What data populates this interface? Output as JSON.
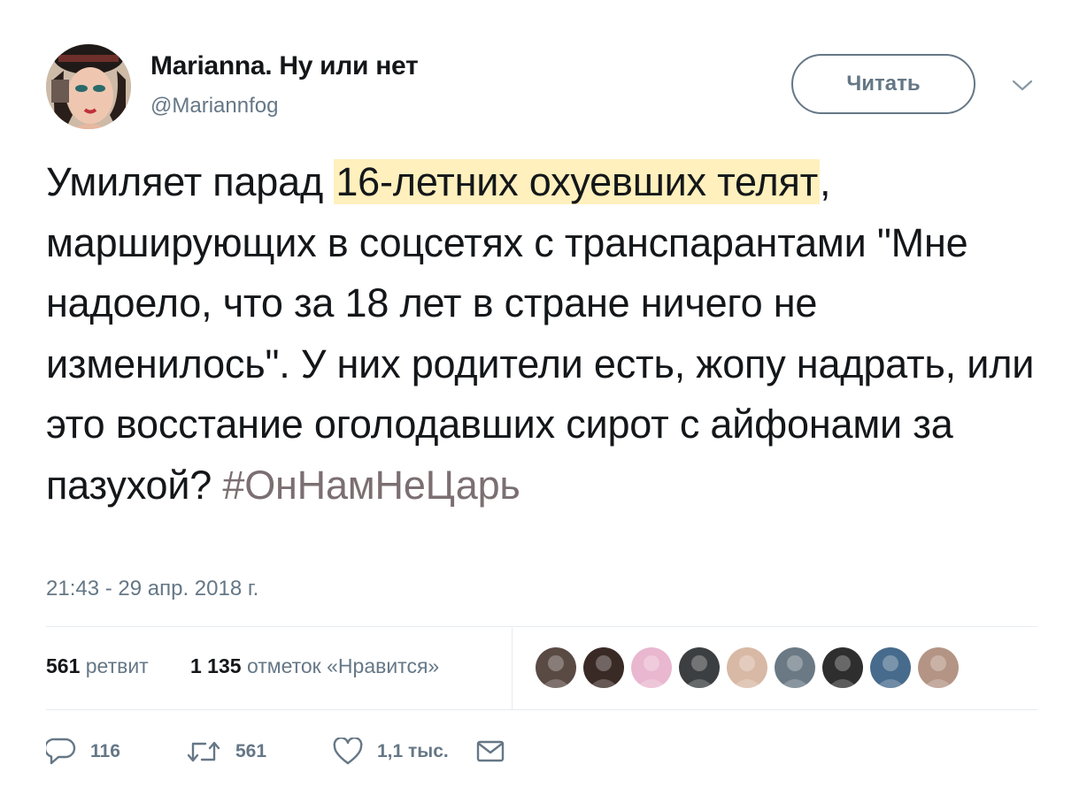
{
  "user": {
    "display_name": "Marianna. Ну или нет",
    "handle": "@Mariannfog"
  },
  "follow_label": "Читать",
  "tweet": {
    "text_before": "Умиляет парад ",
    "text_highlighted": "16-летних охуевших телят",
    "text_after": ", марширующих в соцсетях с транспарантами \"Мне надоело, что за 18 лет в стране ничего не изменилось\". У них родители есть, жопу надрать, или это восстание оголодавших сирот с айфонами за пазухой? ",
    "hashtag": "#ОнНамНеЦарь",
    "timestamp": "21:43 - 29 апр. 2018 г."
  },
  "stats": {
    "retweets_count": "561",
    "retweets_label": "ретвит",
    "likes_count": "1 135",
    "likes_label": "отметок «Нравится»"
  },
  "likers": [
    {
      "name": "liker-1",
      "color": "#5a4a44"
    },
    {
      "name": "liker-2",
      "color": "#3a2a26"
    },
    {
      "name": "liker-3",
      "color": "#e9b7cf"
    },
    {
      "name": "liker-4",
      "color": "#3c3f41"
    },
    {
      "name": "liker-5",
      "color": "#d8b9a5"
    },
    {
      "name": "liker-6",
      "color": "#6a7984"
    },
    {
      "name": "liker-7",
      "color": "#2e2e2e"
    },
    {
      "name": "liker-8",
      "color": "#476b8c"
    },
    {
      "name": "liker-9",
      "color": "#b49484"
    }
  ],
  "actions": {
    "reply_count": "116",
    "retweet_count": "561",
    "like_count": "1,1 тыс."
  },
  "colors": {
    "highlight": "#fff0bd",
    "hashtag": "#7b6f72",
    "secondary": "#657786",
    "divider": "#e6ecf0"
  }
}
